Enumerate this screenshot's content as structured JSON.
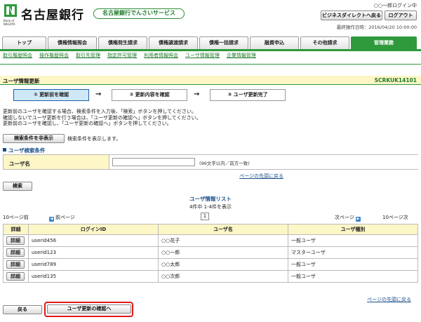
{
  "header": {
    "bank_name": "名古屋銀行",
    "logo_sub": "Bank of NAGOYA",
    "service_name": "名古屋銀行でんさいサービス",
    "user_login": "○○一郎ログイン中",
    "btn_direct": "ビジネスダイレクトへ戻る",
    "btn_logout": "ログアウト",
    "last_operation": "最終操作日時：2016/04/20 10:00:00"
  },
  "global_nav": [
    "トップ",
    "債権情報照会",
    "債権発生請求",
    "債権譲渡請求",
    "債権一括請求",
    "融資申込",
    "その他請求",
    "管理業務"
  ],
  "sub_nav": [
    "取引履歴照会",
    "操作履歴照会",
    "取引先管理",
    "指定許可管理",
    "利用者情報照会",
    "ユーザ情報管理",
    "企業情報管理"
  ],
  "page": {
    "title": "ユーザ情報更新",
    "screen_id": "SCRKUK14101"
  },
  "steps": [
    "① 更新前を確認",
    "② 更新内容を確認",
    "③ ユーザ更新完了"
  ],
  "step_arrow": "→",
  "instructions": [
    "更新前のユーザを確認する場合、検索条件を入力後、「検索」ボタンを押してください。",
    "確認しないでユーザ更新を行う場合は、「ユーザ更新の確認へ」ボタンを押してください。",
    "更新前のユーザを確認し、「ユーザ更新の確認へ」ボタンを押してください。"
  ],
  "search": {
    "toggle_btn": "検索条件を非表示",
    "toggle_note": "検索条件を表示します。",
    "section_title": "ユーザ検索条件",
    "user_name_label": "ユーザ名",
    "user_name_value": "",
    "user_name_hint": "(96文字以内／前方一致)",
    "to_top": "ページの先頭に戻る",
    "search_btn": "検索"
  },
  "list": {
    "title": "ユーザ情報リスト",
    "count": "4件中 1-4件を表示",
    "page": "1",
    "prev10": "10ページ前",
    "prev": "前ページ",
    "next": "次ページ",
    "next10": "10ページ次",
    "headers": [
      "詳細",
      "ログインID",
      "ユーザ名",
      "ユーザ種別"
    ],
    "detail_btn": "詳細",
    "rows": [
      {
        "id": "userid456",
        "name": "○○花子",
        "type": "一般ユーザ"
      },
      {
        "id": "userid123",
        "name": "○○一郎",
        "type": "マスターユーザ"
      },
      {
        "id": "userid789",
        "name": "○○太郎",
        "type": "一般ユーザ"
      },
      {
        "id": "userid135",
        "name": "○○次郎",
        "type": "一般ユーザ"
      }
    ],
    "to_top": "ページの先頭に戻る"
  },
  "footer": {
    "back_btn": "戻る",
    "confirm_btn": "ユーザ更新の確認へ"
  },
  "colors": {
    "brand_green": "#2e9a3c",
    "highlight_red": "#e01818",
    "active_step": "#cfe8f6"
  }
}
